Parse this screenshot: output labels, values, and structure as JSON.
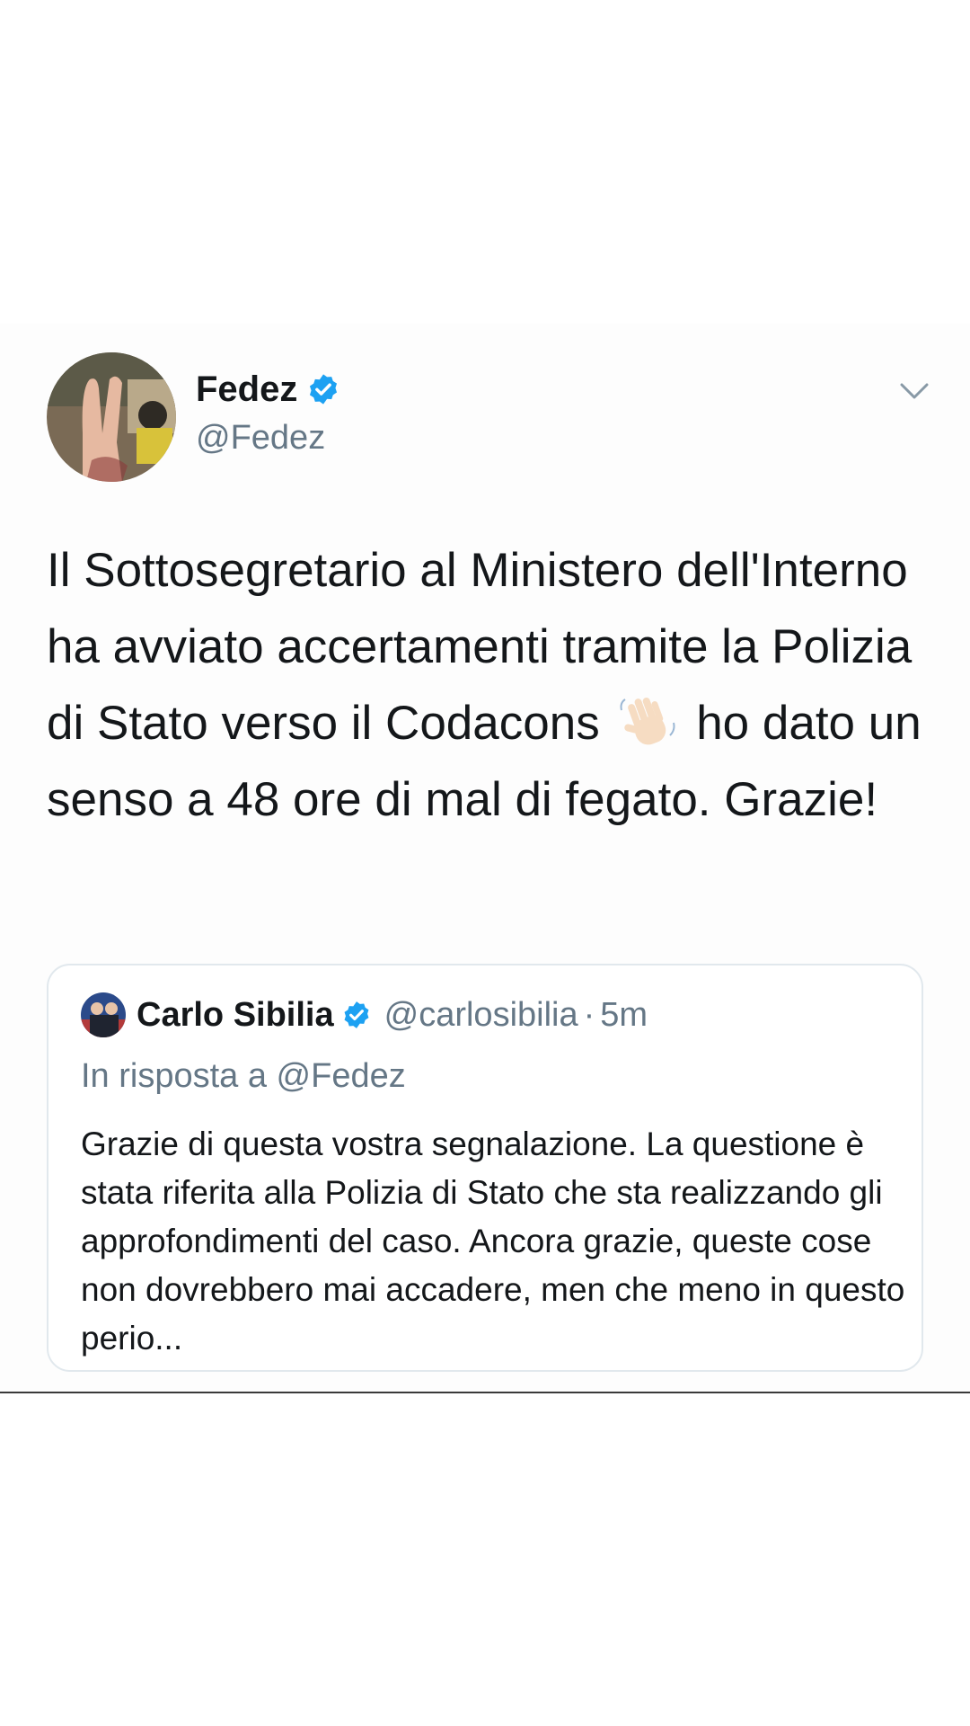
{
  "tweet": {
    "author": {
      "name": "Fedez",
      "handle": "@Fedez",
      "verified": true
    },
    "text_part1": "Il Sottosegretario al Ministero dell'Interno ha avviato accertamenti tramite la Polizia di Stato verso il Codacons",
    "emoji": "waving-hand-emoji",
    "text_part2": "ho dato un senso a 48 ore di mal di fegato. Grazie!",
    "quoted": {
      "name": "Carlo Sibilia",
      "handle": "@carlosibilia",
      "separator": "·",
      "time": "5m",
      "verified": true,
      "reply_to": "In risposta a @Fedez",
      "text": "Grazie di questa vostra segnalazione. La questione è stata riferita alla Polizia di Stato che sta realizzando gli approfondimenti del caso. Ancora grazie, queste cose non dovrebbero mai accadere, men che meno in questo perio..."
    }
  },
  "colors": {
    "verified_blue": "#1da1f2",
    "secondary_text": "#657786",
    "primary_text": "#14171a",
    "border": "#e1e8ed"
  }
}
